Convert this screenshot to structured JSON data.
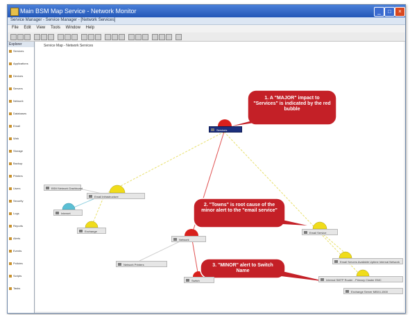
{
  "window": {
    "title": "Main BSM Map Service - Network Monitor",
    "subtitle": "Service Manager - Service Manager - [Network Services]"
  },
  "menu": [
    "File",
    "Edit",
    "View",
    "Tools",
    "Window",
    "Help"
  ],
  "sidebar": {
    "header": "Explorer",
    "items": [
      "Services",
      "Applications",
      "Devices",
      "Servers",
      "Network",
      "Databases",
      "Email",
      "Web",
      "Storage",
      "Backup",
      "Printers",
      "Users",
      "Security",
      "Logs",
      "Reports",
      "Alerts",
      "Events",
      "Policies",
      "Scripts",
      "Tasks"
    ]
  },
  "canvas": {
    "caption": "Service Map - Network Services",
    "nodes": {
      "root": "Services",
      "left_top": "BSM Network Dashboard",
      "left_mid": "Email Infrastructure",
      "left_blue": "Internet",
      "left_low": "Exchange",
      "center": "Network",
      "branch_a": "Network Printers",
      "branch_b": "Switch",
      "right_email": "Email Service",
      "far_right_a": "Email Servers Available Uptime Internal Network",
      "far_right_b": "Internal SMTP Router - Primary Cluster EMC",
      "far_right_c": "Exchange Server MBX4-1500"
    },
    "callouts": {
      "c1": "1. A \"MAJOR\" impact to \"Services\" is indicated by the red bubble",
      "c2": "2. \"Towns\" is root cause of the minor alert to the \"email service\"",
      "c3": "3. \"MINOR\" alert to Switch Name"
    }
  },
  "colors": {
    "major": "#d8201c",
    "minor": "#f0dc1a",
    "info": "#5bbfd4",
    "callout": "#c42027",
    "root_line": "#e05050",
    "yellow_line": "#e8e06a",
    "blue_line": "#8fd0e0"
  }
}
